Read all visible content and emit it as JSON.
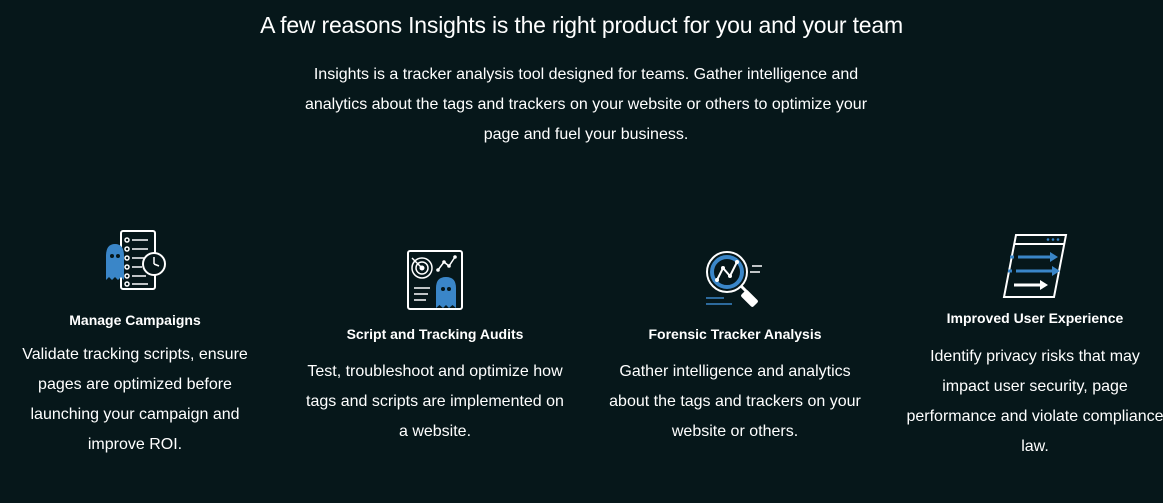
{
  "header": {
    "headline": "A few reasons Insights is the right product for you and your team",
    "intro": "Insights is a tracker analysis tool designed for teams. Gather intelligence and analytics about the tags and trackers on your website or others to optimize your page and fuel your business."
  },
  "colors": {
    "background": "#06171a",
    "text": "#ffffff",
    "accent": "#3a86c8"
  },
  "features": [
    {
      "icon": "ghost-checklist-clock-icon",
      "title": "Manage Campaigns",
      "description": "Validate tracking scripts, ensure pages are optimized before launching your campaign and improve ROI."
    },
    {
      "icon": "ghost-target-chart-icon",
      "title": "Script and Tracking Audits",
      "description": "Test, troubleshoot and optimize how tags and scripts are implemented on a website."
    },
    {
      "icon": "magnifier-graph-icon",
      "title": "Forensic Tracker Analysis",
      "description": "Gather intelligence and analytics about the tags and trackers on your website or others."
    },
    {
      "icon": "browser-arrows-icon",
      "title": "Improved User Experience",
      "description": "Identify privacy risks that may impact user security, page performance and violate compliance law."
    }
  ]
}
